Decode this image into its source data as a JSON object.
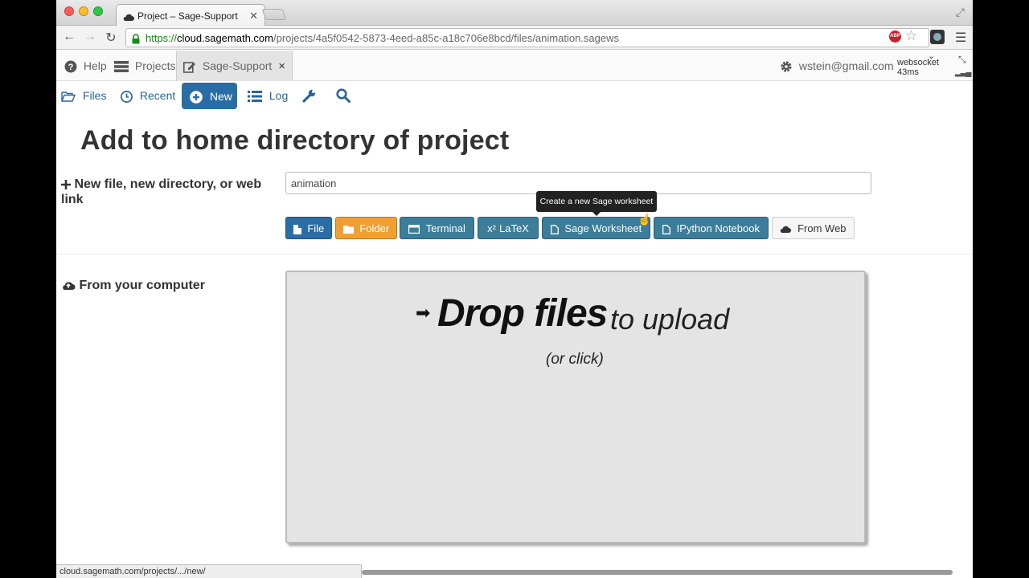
{
  "browser": {
    "tab_title": "Project – Sage-Support",
    "url_scheme": "https://",
    "url_host": "cloud.sagemath.com",
    "url_path": "/projects/4a5f0542-5873-4eed-a85c-a18c706e8bcd/files/animation.sagews",
    "abp_label": "ABP",
    "status_url": "cloud.sagemath.com/projects/.../new/"
  },
  "appnav": {
    "help": "Help",
    "projects": "Projects",
    "project_tab": "Sage-Support",
    "user": "wstein@gmail.com",
    "ws_label": "websocket",
    "ws_latency": "43ms"
  },
  "projnav": {
    "files": "Files",
    "recent": "Recent",
    "new": "New",
    "log": "Log"
  },
  "main": {
    "heading": "Add to home directory of project",
    "new_label": "New file, new directory, or web link",
    "filename_value": "animation",
    "buttons": {
      "file": "File",
      "folder": "Folder",
      "terminal": "Terminal",
      "latex": "LaTeX",
      "latex_prefix": "x²",
      "sage": "Sage Worksheet",
      "ipython": "IPython Notebook",
      "web": "From Web"
    },
    "tooltip": "Create a new Sage worksheet",
    "from_computer": "From your computer",
    "drop_main": "Drop files",
    "drop_sub": "to upload",
    "drop_click": "(or click)"
  },
  "colors": {
    "primary": "#2a6da4",
    "warning": "#f0a030",
    "info": "#3c7d9a"
  }
}
